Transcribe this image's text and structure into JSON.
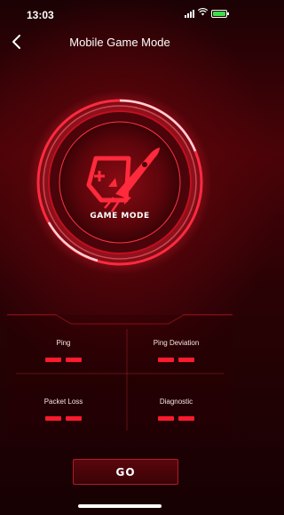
{
  "status_bar": {
    "time": "13:03",
    "battery_color": "#3ddc4a"
  },
  "nav": {
    "title": "Mobile Game Mode",
    "back_icon": "chevron-left-icon"
  },
  "hero": {
    "label": "GAME MODE",
    "icon": "gamepad-rocket-icon",
    "accent_color": "#ff1a2d"
  },
  "stats": [
    {
      "label": "Ping",
      "value": "– –"
    },
    {
      "label": "Ping Deviation",
      "value": "– –"
    },
    {
      "label": "Packet Loss",
      "value": "– –"
    },
    {
      "label": "Diagnostic",
      "value": "– –"
    }
  ],
  "go_button": {
    "label": "GO"
  }
}
